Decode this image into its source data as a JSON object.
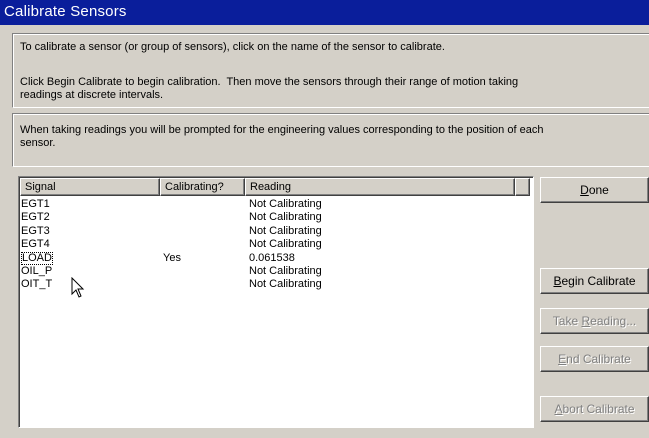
{
  "window": {
    "title": "Calibrate Sensors"
  },
  "instructions": {
    "line1": "To calibrate a sensor (or group of sensors), click on the name of the sensor to calibrate.",
    "line2": "Click Begin Calibrate to begin calibration.  Then move the sensors through their range of motion taking\nreadings at discrete intervals.",
    "line3": "When taking readings you will be prompted for the engineering values corresponding to the position of each\nsensor."
  },
  "list": {
    "columns": [
      "Signal",
      "Calibrating?",
      "Reading"
    ],
    "rows": [
      {
        "signal": "EGT1",
        "calibrating": "",
        "reading": "Not Calibrating"
      },
      {
        "signal": "EGT2",
        "calibrating": "",
        "reading": "Not Calibrating"
      },
      {
        "signal": "EGT3",
        "calibrating": "",
        "reading": "Not Calibrating"
      },
      {
        "signal": "EGT4",
        "calibrating": "",
        "reading": "Not Calibrating"
      },
      {
        "signal": "LOAD",
        "calibrating": "Yes",
        "reading": "0.061538"
      },
      {
        "signal": "OIL_P",
        "calibrating": "",
        "reading": "Not Calibrating"
      },
      {
        "signal": "OIT_T",
        "calibrating": "",
        "reading": "Not Calibrating"
      }
    ]
  },
  "buttons": {
    "done": {
      "label": "Done",
      "accel": "D",
      "enabled": true
    },
    "begin": {
      "label": "Begin Calibrate",
      "accel": "B",
      "enabled": true
    },
    "take": {
      "label": "Take Reading...",
      "accel": "R",
      "enabled": false
    },
    "end": {
      "label": "End Calibrate",
      "accel": "E",
      "enabled": false
    },
    "abort": {
      "label": "Abort Calibrate",
      "accel": "A",
      "enabled": false
    }
  },
  "colors": {
    "titlebar": "#0a1e9b",
    "face": "#d4d0c8"
  },
  "icons": {
    "cursor": "mouse-pointer-icon"
  }
}
